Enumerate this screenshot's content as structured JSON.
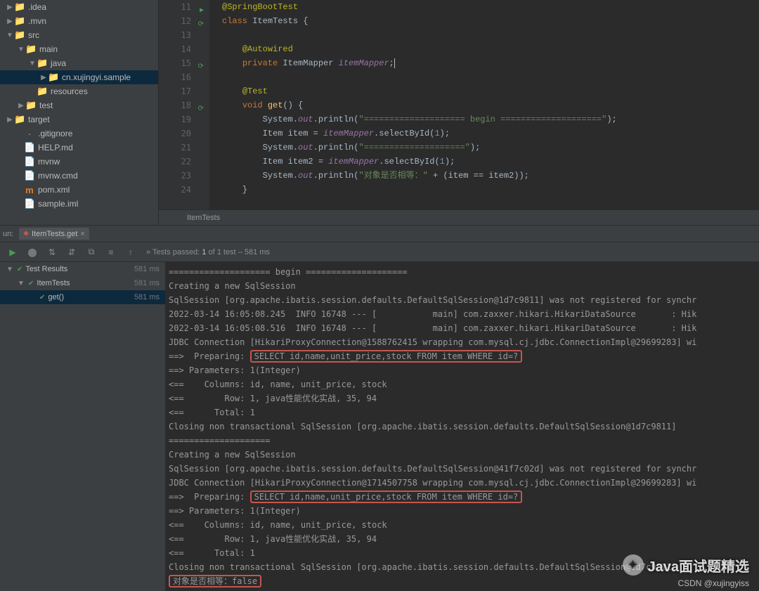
{
  "tree": [
    {
      "pad": 8,
      "arrow": "▶",
      "ico": "📁",
      "cls": "dir",
      "label": ".idea"
    },
    {
      "pad": 8,
      "arrow": "▶",
      "ico": "📁",
      "cls": "dir",
      "label": ".mvn"
    },
    {
      "pad": 8,
      "arrow": "▼",
      "ico": "📁",
      "cls": "dir-blue",
      "label": "src"
    },
    {
      "pad": 24,
      "arrow": "▼",
      "ico": "📁",
      "cls": "dir-blue",
      "label": "main"
    },
    {
      "pad": 40,
      "arrow": "▼",
      "ico": "📁",
      "cls": "dir-blue",
      "label": "java"
    },
    {
      "pad": 56,
      "arrow": "▶",
      "ico": "📁",
      "cls": "dir",
      "label": "cn.xujingyi.sample",
      "sel": true
    },
    {
      "pad": 40,
      "arrow": "",
      "ico": "📁",
      "cls": "dir-green",
      "label": "resources"
    },
    {
      "pad": 24,
      "arrow": "▶",
      "ico": "📁",
      "cls": "dir-green",
      "label": "test"
    },
    {
      "pad": 8,
      "arrow": "▶",
      "ico": "📁",
      "cls": "dir-orange",
      "label": "target"
    },
    {
      "pad": 22,
      "arrow": "",
      "ico": "·",
      "cls": "file",
      "label": ".gitignore"
    },
    {
      "pad": 22,
      "arrow": "",
      "ico": "📄",
      "cls": "file",
      "label": "HELP.md"
    },
    {
      "pad": 22,
      "arrow": "",
      "ico": "📄",
      "cls": "file",
      "label": "mvnw"
    },
    {
      "pad": 22,
      "arrow": "",
      "ico": "📄",
      "cls": "file",
      "label": "mvnw.cmd"
    },
    {
      "pad": 22,
      "arrow": "",
      "ico": "m",
      "cls": "f-m",
      "label": "pom.xml"
    },
    {
      "pad": 22,
      "arrow": "",
      "ico": "📄",
      "cls": "file",
      "label": "sample.iml"
    }
  ],
  "code": {
    "lines": [
      {
        "n": 11,
        "mark": "green",
        "html": "<span class='k-annot'>@SpringBootTest</span>"
      },
      {
        "n": 12,
        "mark": "green-ring",
        "html": "<span class='k-kw'>class</span> ItemTests {"
      },
      {
        "n": 13,
        "html": ""
      },
      {
        "n": 14,
        "html": "    <span class='k-annot'>@Autowired</span>"
      },
      {
        "n": 15,
        "mark": "green-ring",
        "html": "    <span class='k-kw'>private</span> ItemMapper <span class='k-field'>itemMapper</span><span class='caret'>;</span>"
      },
      {
        "n": 16,
        "html": ""
      },
      {
        "n": 17,
        "html": "    <span class='k-annot'>@Test</span>"
      },
      {
        "n": 18,
        "mark": "green-ring",
        "html": "    <span class='k-kw'>void</span> <span class='k-method'>get</span>() {"
      },
      {
        "n": 19,
        "html": "        System.<span class='k-static'>out</span>.println(<span class='k-str'>\"==================== begin ====================\"</span>);"
      },
      {
        "n": 20,
        "html": "        Item item = <span class='k-field'>itemMapper</span>.selectById(<span class='k-num'>1</span>);"
      },
      {
        "n": 21,
        "html": "        System.<span class='k-static'>out</span>.println(<span class='k-str'>\"====================\"</span>);"
      },
      {
        "n": 22,
        "html": "        Item item2 = <span class='k-field'>itemMapper</span>.selectById(<span class='k-num'>1</span>);"
      },
      {
        "n": 23,
        "html": "        System.<span class='k-static'>out</span>.println(<span class='k-str'>\"对象是否相等：\"</span> + (item == item2));"
      },
      {
        "n": 24,
        "html": "    }"
      }
    ],
    "breadcrumb": "ItemTests"
  },
  "run": {
    "run_label": "un:",
    "tab_label": "ItemTests.get",
    "status_prefix": "»  Tests passed:",
    "status_count": "1",
    "status_of": "of 1 test",
    "status_time": "– 581 ms",
    "tests": [
      {
        "pad": 8,
        "arrow": "▼",
        "label": "Test Results",
        "ms": "581 ms",
        "sel": false
      },
      {
        "pad": 24,
        "arrow": "▼",
        "label": "ItemTests",
        "ms": "581 ms",
        "sel": false
      },
      {
        "pad": 40,
        "arrow": "",
        "label": "get()",
        "ms": "581 ms",
        "sel": true
      }
    ]
  },
  "console_lines": [
    {
      "t": "==================== begin ===================="
    },
    {
      "t": "Creating a new SqlSession"
    },
    {
      "t": "SqlSession [org.apache.ibatis.session.defaults.DefaultSqlSession@1d7c9811] was not registered for synchr"
    },
    {
      "t": "2022-03-14 16:05:08.245  INFO 16748 --- [           main] com.zaxxer.hikari.HikariDataSource       : Hik"
    },
    {
      "t": "2022-03-14 16:05:08.516  INFO 16748 --- [           main] com.zaxxer.hikari.HikariDataSource       : Hik"
    },
    {
      "t": "JDBC Connection [HikariProxyConnection@1588762415 wrapping com.mysql.cj.jdbc.ConnectionImpl@29699283] wi"
    },
    {
      "pre": "==>  Preparing: ",
      "box": "SELECT id,name,unit_price,stock FROM item WHERE id=?"
    },
    {
      "t": "==> Parameters: 1(Integer)"
    },
    {
      "t": "<==    Columns: id, name, unit_price, stock"
    },
    {
      "t": "<==        Row: 1, java性能优化实战, 35, 94"
    },
    {
      "t": "<==      Total: 1"
    },
    {
      "t": "Closing non transactional SqlSession [org.apache.ibatis.session.defaults.DefaultSqlSession@1d7c9811]"
    },
    {
      "t": "===================="
    },
    {
      "t": "Creating a new SqlSession"
    },
    {
      "t": "SqlSession [org.apache.ibatis.session.defaults.DefaultSqlSession@41f7c02d] was not registered for synchr"
    },
    {
      "t": "JDBC Connection [HikariProxyConnection@1714507758 wrapping com.mysql.cj.jdbc.ConnectionImpl@29699283] wi"
    },
    {
      "pre": "==>  Preparing: ",
      "box": "SELECT id,name,unit_price,stock FROM item WHERE id=?"
    },
    {
      "t": "==> Parameters: 1(Integer)"
    },
    {
      "t": "<==    Columns: id, name, unit_price, stock"
    },
    {
      "t": "<==        Row: 1, java性能优化实战, 35, 94"
    },
    {
      "t": "<==      Total: 1"
    },
    {
      "t": "Closing non transactional SqlSession [org.apache.ibatis.session.defaults.DefaultSqlSession@1d7c9811]"
    },
    {
      "box": "对象是否相等：false"
    }
  ],
  "watermark": {
    "text": "Java面试题精选",
    "csdn": "CSDN @xujingyiss"
  }
}
